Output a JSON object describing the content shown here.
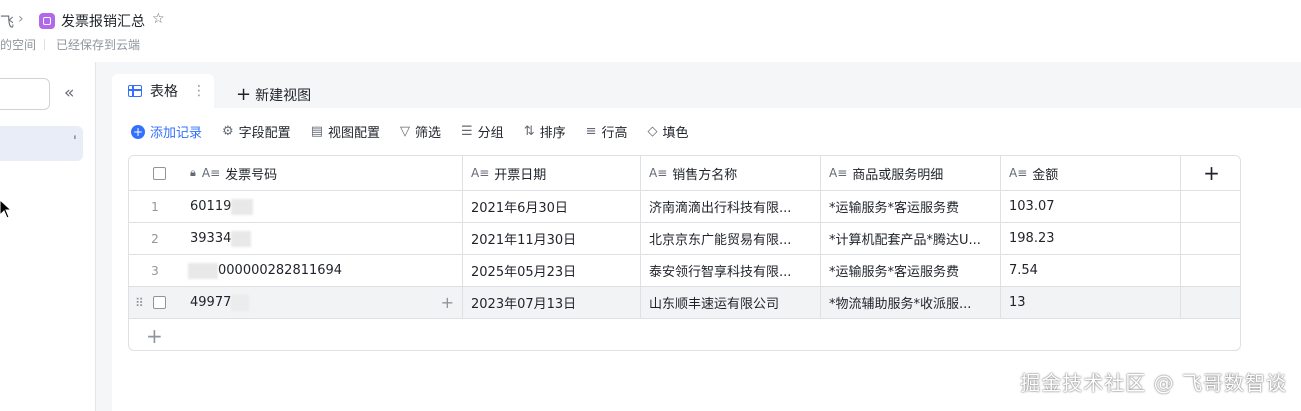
{
  "header": {
    "breadcrumb_prev": "飞",
    "breadcrumb_sep": "›",
    "title": "发票报销汇总",
    "star_icon": "star-outline-icon",
    "space_name": "的空间",
    "save_status": "已经保存到云端"
  },
  "sidebar": {
    "collapse_icon": "double-chevron-left-icon",
    "item_more_icon": "more-vertical-icon"
  },
  "tabs": {
    "active_label": "表格",
    "new_view_label": "新建视图"
  },
  "toolbar": {
    "add_record": "添加记录",
    "field_config": "字段配置",
    "view_config": "视图配置",
    "filter": "筛选",
    "group": "分组",
    "sort": "排序",
    "row_height": "行高",
    "fill_color": "填色"
  },
  "table": {
    "columns": [
      "发票号码",
      "开票日期",
      "销售方名称",
      "商品或服务明细",
      "金额"
    ],
    "rows": [
      {
        "num": "1",
        "invoice_no": "60119",
        "date": "2021年6月30日",
        "seller": "济南滴滴出行科技有限...",
        "goods": "*运输服务*客运服务费",
        "amount": "103.07"
      },
      {
        "num": "2",
        "invoice_no": "39334",
        "date": "2021年11月30日",
        "seller": "北京京东广能贸易有限...",
        "goods": "*计算机配套产品*腾达U...",
        "amount": "198.23"
      },
      {
        "num": "3",
        "invoice_no": "000000282811694",
        "date": "2025年05月23日",
        "seller": "泰安领行智享科技有限...",
        "goods": "*运输服务*客运服务费",
        "amount": "7.54"
      },
      {
        "num": "",
        "invoice_no": "49977",
        "date": "2023年07月13日",
        "seller": "山东顺丰速运有限公司",
        "goods": "*物流辅助服务*收派服...",
        "amount": "13"
      }
    ]
  },
  "watermark": "掘金技术社区 @ 飞哥数智谈",
  "colors": {
    "accent": "#3370ff",
    "doc_icon": "#b168ea",
    "selected_row": "#f2f3f5"
  }
}
